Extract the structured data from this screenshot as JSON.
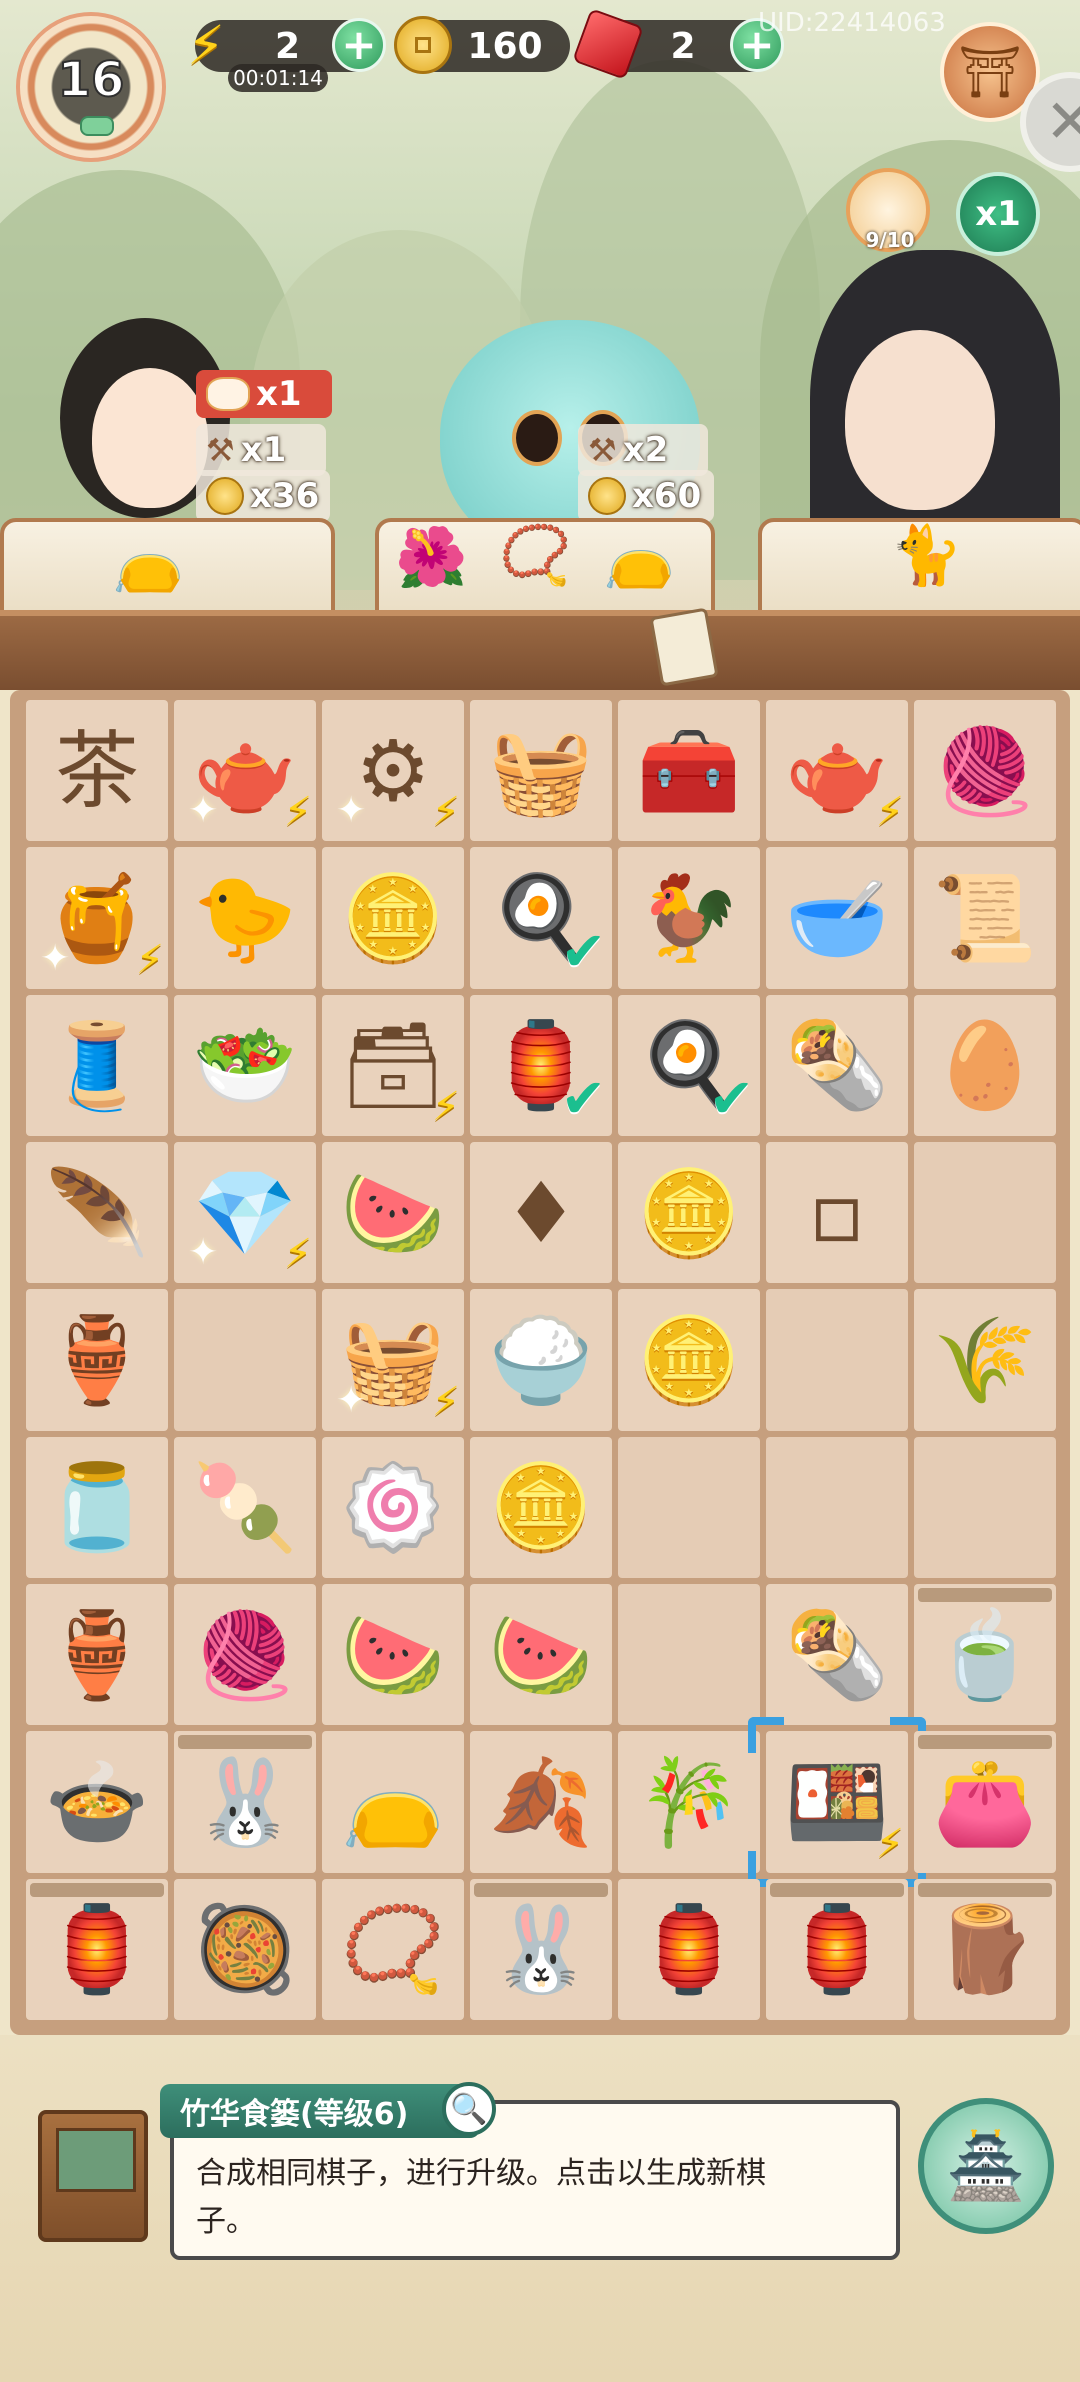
{
  "hud": {
    "level": "16",
    "energy": "2",
    "energy_timer": "00:01:14",
    "coins": "160",
    "gems": "2",
    "plus": "+",
    "uid": "UID:22414063",
    "cat_progress": "9/10",
    "multiplier": "x1"
  },
  "orders": {
    "left": {
      "cat_count": "x1",
      "hammer": "x1",
      "coins": "x36"
    },
    "middle": {
      "hammer": "x2",
      "coins": "x60"
    }
  },
  "board": {
    "rows": [
      [
        {
          "icon": "茶",
          "kind": "tea-crate"
        },
        {
          "icon": "🫖",
          "kind": "teapot",
          "bolt": true,
          "sparkle": true
        },
        {
          "icon": "⚙",
          "kind": "spinning-wheel",
          "bolt": true,
          "sparkle": true
        },
        {
          "icon": "🧺",
          "kind": "basket"
        },
        {
          "icon": "🧰",
          "kind": "wooden-chest"
        },
        {
          "icon": "🫖",
          "kind": "teapot-set",
          "bolt": true
        },
        {
          "icon": "🧶",
          "kind": "cotton-bowl"
        }
      ],
      [
        {
          "icon": "🍯",
          "kind": "rice-jar",
          "bolt": true,
          "sparkle": true
        },
        {
          "icon": "🐤",
          "kind": "chick-nest"
        },
        {
          "icon": "🪙",
          "kind": "coins"
        },
        {
          "icon": "🍳",
          "kind": "fried-egg",
          "check": true
        },
        {
          "icon": "🐓",
          "kind": "rooster"
        },
        {
          "icon": "🥣",
          "kind": "porridge-bowl"
        },
        {
          "icon": "📜",
          "kind": "silk-scroll"
        }
      ],
      [
        {
          "icon": "🧵",
          "kind": "thread-spools"
        },
        {
          "icon": "🥗",
          "kind": "pea-bowl"
        },
        {
          "icon": "🗃",
          "kind": "tool-box",
          "bolt": true
        },
        {
          "icon": "🏮",
          "kind": "lantern",
          "check": true
        },
        {
          "icon": "🍳",
          "kind": "fried-egg",
          "check": true
        },
        {
          "icon": "🌯",
          "kind": "rice-rolls"
        },
        {
          "icon": "🥚",
          "kind": "egg-nest"
        }
      ],
      [
        {
          "icon": "🪶",
          "kind": "feather"
        },
        {
          "icon": "💎",
          "kind": "jewel-chest",
          "bolt": true,
          "sparkle": true
        },
        {
          "icon": "🍉",
          "kind": "fruit-plate"
        },
        {
          "icon": "♦",
          "kind": "red-gems"
        },
        {
          "icon": "🪙",
          "kind": "coin"
        },
        {
          "icon": "▫",
          "kind": "tofu-box"
        },
        {
          "icon": "",
          "kind": "empty"
        }
      ],
      [
        {
          "icon": "🏺",
          "kind": "energy-vase"
        },
        {
          "icon": "",
          "kind": "empty"
        },
        {
          "icon": "🧺",
          "kind": "yarn-basket",
          "bolt": true,
          "sparkle": true
        },
        {
          "icon": "🍚",
          "kind": "rice-bowl"
        },
        {
          "icon": "🪙",
          "kind": "coin"
        },
        {
          "icon": "",
          "kind": "empty"
        },
        {
          "icon": "🌾",
          "kind": "wheat-bundle"
        }
      ],
      [
        {
          "icon": "🫙",
          "kind": "tea-jar"
        },
        {
          "icon": "🍡",
          "kind": "bun"
        },
        {
          "icon": "🍥",
          "kind": "pig-bun"
        },
        {
          "icon": "🪙",
          "kind": "coin-stack"
        },
        {
          "icon": "",
          "kind": "empty"
        },
        {
          "icon": "",
          "kind": "empty"
        },
        {
          "icon": "",
          "kind": "empty"
        }
      ],
      [
        {
          "icon": "🏺",
          "kind": "energy-gourd"
        },
        {
          "icon": "🧶",
          "kind": "spindle"
        },
        {
          "icon": "🍉",
          "kind": "watermelon-slice"
        },
        {
          "icon": "🍉",
          "kind": "watermelon-half"
        },
        {
          "icon": "",
          "kind": "empty"
        },
        {
          "icon": "🌯",
          "kind": "rice-rolls"
        },
        {
          "icon": "🍵",
          "kind": "green-tea",
          "cobweb": true
        }
      ],
      [
        {
          "icon": "🍲",
          "kind": "soup-bowl"
        },
        {
          "icon": "🐰",
          "kind": "bunny-bowl",
          "cobweb": true
        },
        {
          "icon": "👝",
          "kind": "purple-pouch"
        },
        {
          "icon": "🍂",
          "kind": "tea-leaves"
        },
        {
          "icon": "🎋",
          "kind": "bamboo"
        },
        {
          "icon": "🍱",
          "kind": "food-basket",
          "selected": true,
          "bolt": true
        },
        {
          "icon": "👛",
          "kind": "embroidered-bag",
          "cobweb": true
        }
      ],
      [
        {
          "icon": "🏮",
          "kind": "lantern",
          "cobweb": true
        },
        {
          "icon": "🥘",
          "kind": "fried-rice-plate"
        },
        {
          "icon": "📿",
          "kind": "hairpin"
        },
        {
          "icon": "🐰",
          "kind": "bunny-bowl",
          "cobweb": true
        },
        {
          "icon": "🏮",
          "kind": "palace-lantern"
        },
        {
          "icon": "🏮",
          "kind": "lantern",
          "cobweb": true
        },
        {
          "icon": "🪵",
          "kind": "wooden-crate",
          "cobweb": true
        }
      ]
    ]
  },
  "info": {
    "title": "竹华食篓(等级6)",
    "description": "合成相同棋子，进行升级。点击以生成新棋子。"
  },
  "icons": {
    "energy": "lightning-icon",
    "coin": "coin-icon",
    "gem": "gem-icon",
    "shop": "shop-icon",
    "close": "close-icon",
    "search": "magnifier-icon",
    "pagoda": "pagoda-icon"
  },
  "colors": {
    "accent_green": "#2c6e5d",
    "selection_blue": "#3aa0e0",
    "board_tile": "#e9d2bc"
  }
}
